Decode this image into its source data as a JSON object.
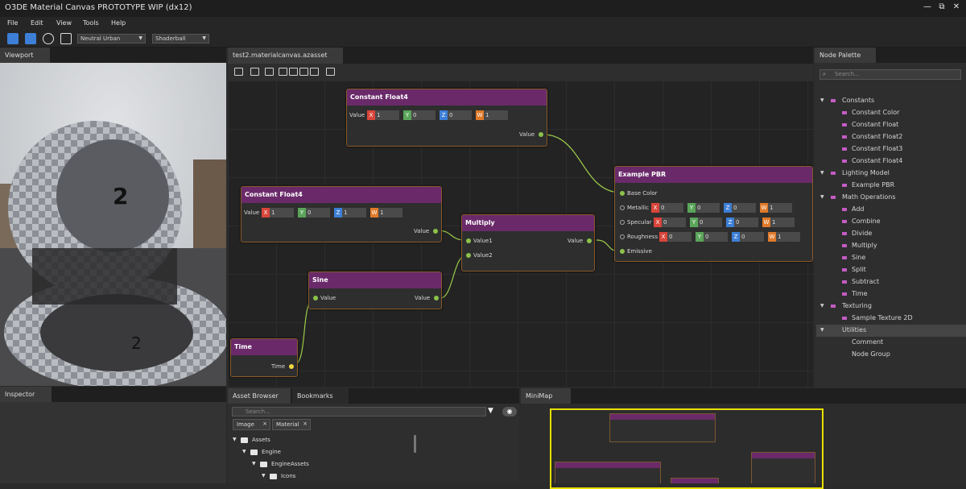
{
  "window": {
    "title": "O3DE Material Canvas PROTOTYPE WIP (dx12)",
    "minimize": "—",
    "restore": "⧉",
    "close": "✕"
  },
  "menu": [
    "File",
    "Edit",
    "View",
    "Tools",
    "Help"
  ],
  "toolbar": {
    "lighting_preset": "Neutral Urban",
    "model_preset": "Shaderball"
  },
  "viewport": {
    "tab": "Viewport",
    "label_top": "2",
    "label_bottom": "2"
  },
  "inspector": {
    "tab": "Inspector"
  },
  "document": {
    "tab": "test2.materialcanvas.azasset"
  },
  "nodes": {
    "cf_top": {
      "title": "Constant Float4",
      "input_label": "Value",
      "x": "1",
      "y": "0",
      "z": "0",
      "w": "1",
      "output_label": "Value"
    },
    "cf_left": {
      "title": "Constant Float4",
      "input_label": "Value",
      "x": "1",
      "y": "0",
      "z": "1",
      "w": "1",
      "output_label": "Value"
    },
    "multiply": {
      "title": "Multiply",
      "in1": "Value1",
      "in2": "Value2",
      "out": "Value"
    },
    "sine": {
      "title": "Sine",
      "in": "Value",
      "out": "Value"
    },
    "time": {
      "title": "Time",
      "out": "Time"
    },
    "pbr": {
      "title": "Example PBR",
      "base_color": "Base Color",
      "metallic": {
        "label": "Metallic",
        "x": "0",
        "y": "0",
        "z": "0",
        "w": "1"
      },
      "specular": {
        "label": "Specular",
        "x": "0",
        "y": "0",
        "z": "0",
        "w": "1"
      },
      "roughness": {
        "label": "Roughness",
        "x": "0",
        "y": "0",
        "z": "0",
        "w": "1"
      },
      "emissive": "Emissive"
    }
  },
  "palette": {
    "tab": "Node Palette",
    "search_placeholder": "Search...",
    "rows": [
      {
        "label": "Constants",
        "level": 0
      },
      {
        "label": "Constant Color",
        "level": 1
      },
      {
        "label": "Constant Float",
        "level": 1
      },
      {
        "label": "Constant Float2",
        "level": 1
      },
      {
        "label": "Constant Float3",
        "level": 1
      },
      {
        "label": "Constant Float4",
        "level": 1
      },
      {
        "label": "Lighting Model",
        "level": 0
      },
      {
        "label": "Example PBR",
        "level": 1
      },
      {
        "label": "Math Operations",
        "level": 0
      },
      {
        "label": "Add",
        "level": 1
      },
      {
        "label": "Combine",
        "level": 1
      },
      {
        "label": "Divide",
        "level": 1
      },
      {
        "label": "Multiply",
        "level": 1
      },
      {
        "label": "Sine",
        "level": 1
      },
      {
        "label": "Split",
        "level": 1
      },
      {
        "label": "Subtract",
        "level": 1
      },
      {
        "label": "Time",
        "level": 1
      },
      {
        "label": "Texturing",
        "level": 0
      },
      {
        "label": "Sample Texture 2D",
        "level": 1
      },
      {
        "label": "Utilities",
        "level": 0
      },
      {
        "label": "Comment",
        "level": 2
      },
      {
        "label": "Node Group",
        "level": 2
      }
    ]
  },
  "asset_browser": {
    "tab": "Asset Browser",
    "tab2": "Bookmarks",
    "search_placeholder": "Search...",
    "chip1": "Image",
    "chip2": "Material",
    "chip_close": "×",
    "tree": [
      "Assets",
      "Engine",
      "EngineAssets",
      "Icons"
    ]
  },
  "minimap": {
    "tab": "MiniMap"
  },
  "colors": {
    "node_header": "#6a2a6a",
    "pin": "#8bc34a",
    "accent_yellow": "#e8e000"
  }
}
